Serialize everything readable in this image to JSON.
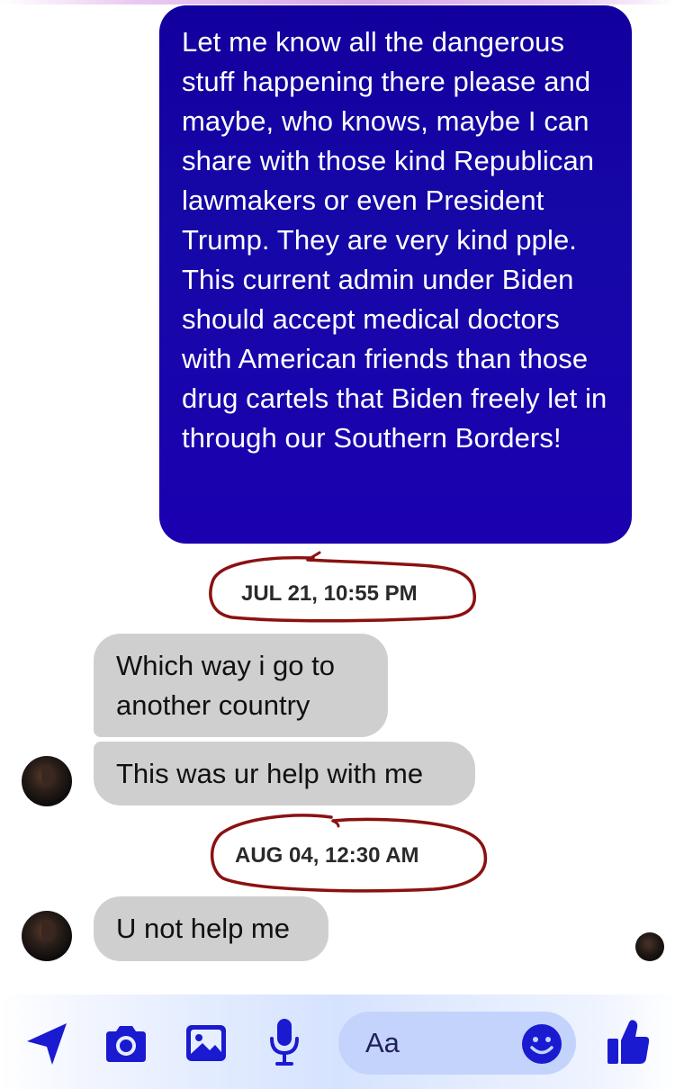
{
  "conversation": {
    "outgoing_message": "Let me know all the dangerous stuff happening there please and maybe, who knows, maybe I can share with those kind Republican lawmakers or even President Trump. They are very kind pple. This current admin under Biden should accept medical doctors with American friends than those drug cartels that Biden freely let in through our Southern Borders!",
    "timestamp_1": "JUL 21, 10:55 PM",
    "incoming_1": "Which way i go to another country",
    "incoming_2": "This was ur help with me",
    "timestamp_2": "AUG 04, 12:30 AM",
    "incoming_3": "U not help me"
  },
  "composer": {
    "placeholder": "Aa",
    "icons": [
      "location-arrow-icon",
      "camera-icon",
      "gallery-icon",
      "microphone-icon",
      "emoji-icon",
      "thumbs-up-icon"
    ]
  },
  "colors": {
    "outgoing_bubble": "#1608a8",
    "incoming_bubble": "#cfcfcf",
    "accent_icon": "#1a1ad0",
    "annotation_circle": "#8b1111"
  }
}
